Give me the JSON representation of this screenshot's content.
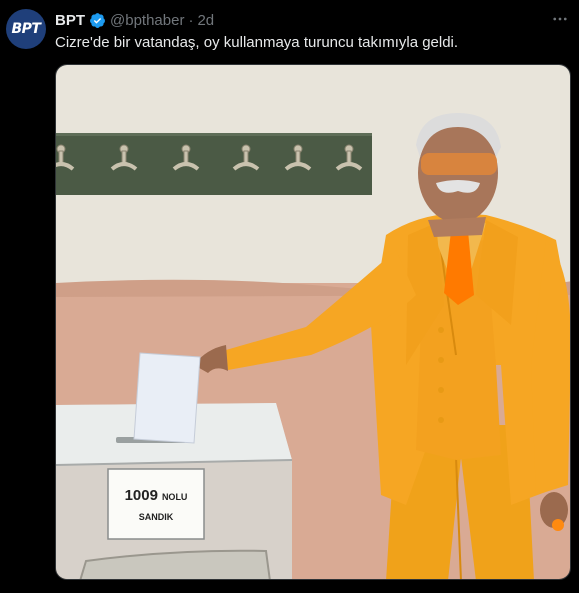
{
  "account": {
    "avatar_text": "BPT",
    "display_name": "BPT",
    "handle": "@bpthaber",
    "separator": "·",
    "time": "2d"
  },
  "tweet": {
    "text": "Cizre'de bir vatandaş, oy kullanmaya turuncu takımıyla geldi."
  },
  "media": {
    "ballot_box_number": "1009",
    "ballot_box_suffix": "NOLU",
    "ballot_box_word": "SANDIK"
  },
  "colors": {
    "background": "#000000",
    "text": "#e7e9ea",
    "muted": "#71767b",
    "verified": "#1d9bf0",
    "suit": "#f6a623"
  },
  "icons": {
    "verified": "verified-badge-icon",
    "more": "more-options-icon"
  }
}
